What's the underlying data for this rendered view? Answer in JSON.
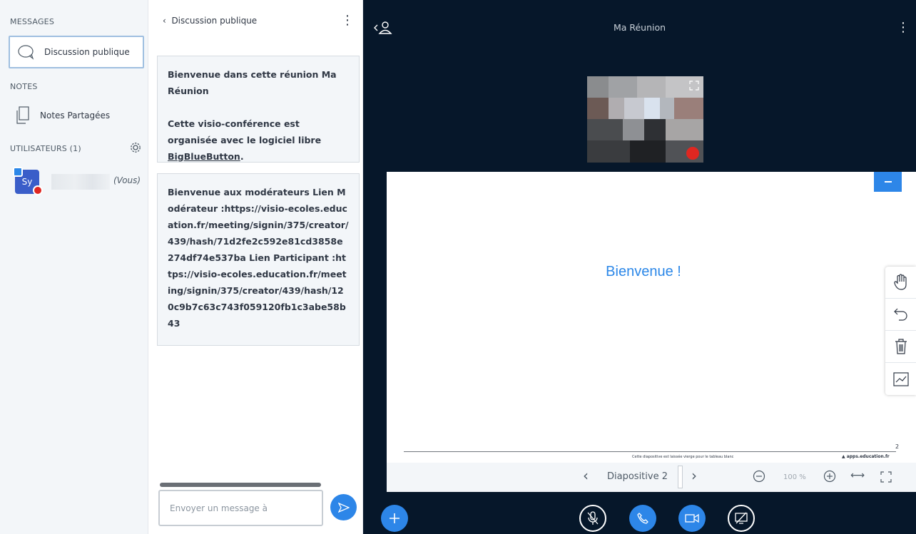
{
  "sidebar": {
    "messages_title": "MESSAGES",
    "public_chat_label": "Discussion publique",
    "notes_title": "NOTES",
    "shared_notes_label": "Notes Partagées",
    "users_title": "UTILISATEURS (1)",
    "user": {
      "initials": "Sy",
      "you_label": "(Vous)"
    }
  },
  "chat": {
    "header": "Discussion publique",
    "messages": [
      {
        "text_a": "Bienvenue dans cette réunion Ma Réunion\n\nCette visio-conférence est organisée avec le logiciel libre ",
        "link": "BigBlueButton",
        "text_b": "."
      },
      {
        "text": "Bienvenue aux modérateurs Lien Modérateur :https://visio-ecoles.education.fr/meeting/signin/375/creator/439/hash/71d2fe2c592e81cd3858e274df74e537ba Lien Participant :https://visio-ecoles.education.fr/meeting/signin/375/creator/439/hash/120c9b7c63c743f059120fb1c3abe58b43"
      }
    ],
    "input_placeholder": "Envoyer un message à"
  },
  "meeting": {
    "title": "Ma Réunion",
    "slide": {
      "text": "Bienvenue !",
      "page_number": "2",
      "footer": "Cette diapositive est laissée vierge pour le tableau blanc",
      "logo": "apps.education.fr"
    },
    "toolbar": {
      "slide_label": "Diapositive 2",
      "zoom": "100 %"
    }
  },
  "colors": {
    "accent": "#2d86e8",
    "meeting_bg": "#06172a",
    "sidebar_bg": "#f3f6f9",
    "mic_muted": "#df2721"
  },
  "icons": [
    "chat-bubble-icon",
    "notes-icon",
    "gear-icon",
    "back-chevron-icon",
    "kebab-icon",
    "send-icon",
    "users-toggle-icon",
    "expand-icon",
    "mic-muted-icon",
    "minimize-icon",
    "hand-icon",
    "undo-icon",
    "trash-icon",
    "multi-user-whiteboard-icon",
    "plus-icon",
    "phone-icon",
    "camera-icon",
    "screenshare-off-icon",
    "zoom-out-icon",
    "zoom-in-icon",
    "fit-width-icon",
    "fullscreen-icon"
  ]
}
